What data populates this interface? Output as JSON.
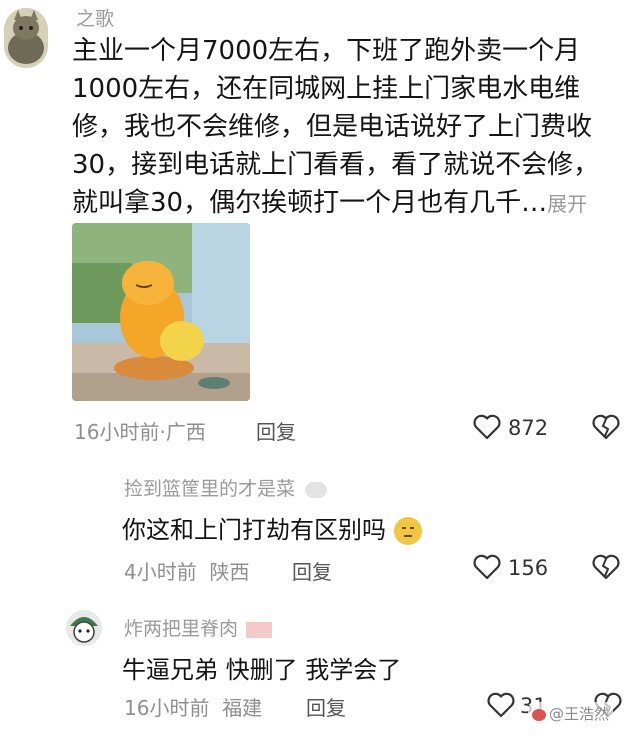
{
  "comment1": {
    "username": "之歌",
    "lines": [
      "主业一个月7000左右，下班了跑外卖一个月",
      "1000左右，还在同城网上挂上门家电水电维",
      "修，我也不会维修，但是电话说好了上门费收",
      "30，接到电话就上门看看，看了就说不会修，",
      "就叫拿30，偶尔挨顿打一个月也有几千…"
    ],
    "expand_label": "展开",
    "time": "16小时前",
    "location": "广西",
    "reply_label": "回复",
    "likes": "872"
  },
  "reply1": {
    "username": "捡到篮筐里的才是菜",
    "text": "你这和上门打劫有区别吗",
    "time": "4小时前",
    "location": "陕西",
    "reply_label": "回复",
    "likes": "156"
  },
  "reply2": {
    "username": "炸两把里脊肉",
    "text": "牛逼兄弟 快删了 我学会了",
    "time": "16小时前",
    "location": "福建",
    "reply_label": "回复",
    "likes": "31"
  },
  "watermark": "@王浩然",
  "colors": {
    "accent_text": "#141414",
    "muted": "#9a9a9a",
    "background": "#ffffff"
  },
  "icons": {
    "like": "heart-outline-icon",
    "dislike": "broken-heart-icon"
  }
}
